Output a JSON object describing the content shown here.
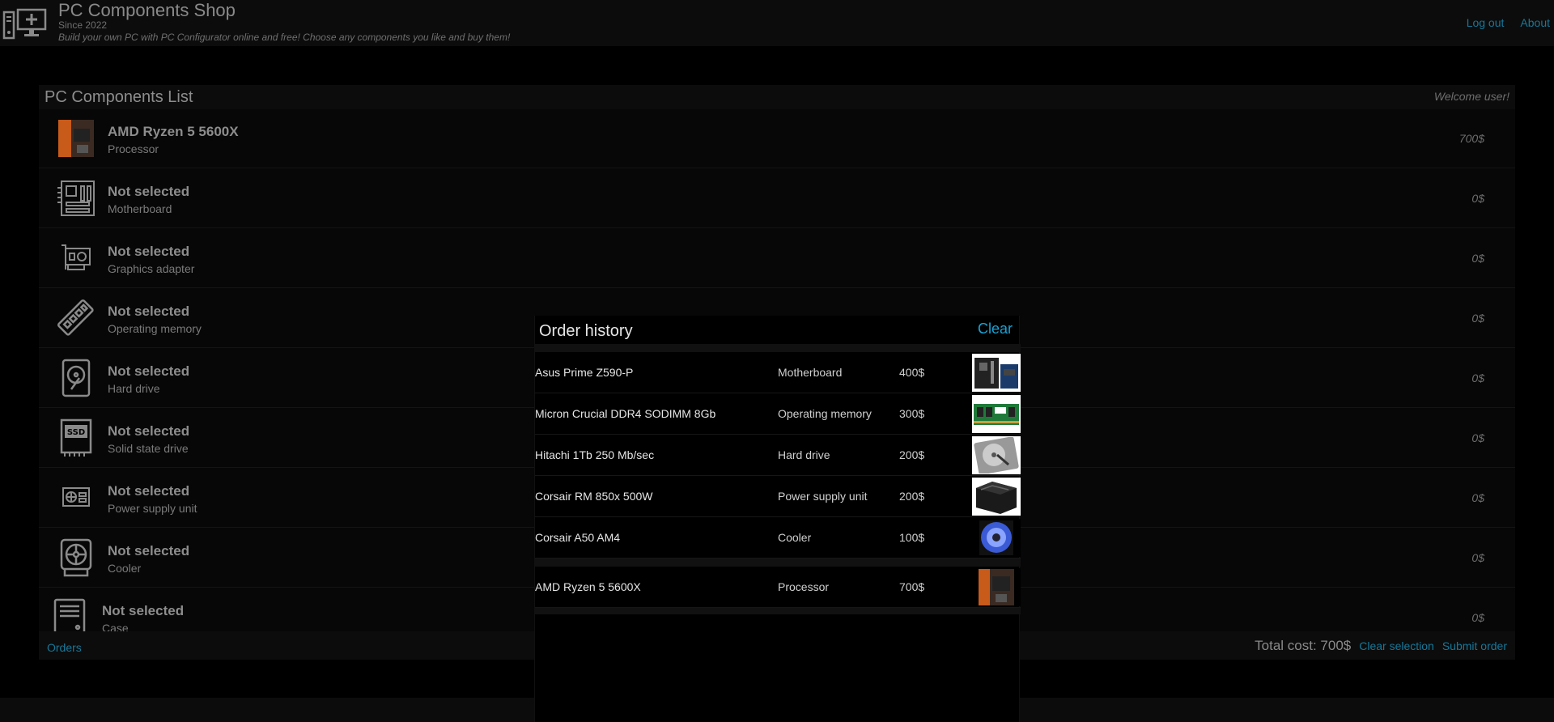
{
  "header": {
    "title": "PC Components Shop",
    "since": "Since 2022",
    "tagline": "Build your own PC with PC Configurator online and free! Choose any components you like and buy them!",
    "nav": {
      "logout": "Log out",
      "about": "About"
    }
  },
  "panel": {
    "title": "PC Components List",
    "welcome": "Welcome  user!",
    "components": [
      {
        "name": "AMD Ryzen 5 5600X",
        "type": "Processor",
        "price": "700$",
        "icon": "cpu-box-icon"
      },
      {
        "name": "Not selected",
        "type": "Motherboard",
        "price": "0$",
        "icon": "motherboard-icon"
      },
      {
        "name": "Not selected",
        "type": "Graphics adapter",
        "price": "0$",
        "icon": "gpu-icon"
      },
      {
        "name": "Not selected",
        "type": "Operating memory",
        "price": "0$",
        "icon": "ram-icon"
      },
      {
        "name": "Not selected",
        "type": "Hard drive",
        "price": "0$",
        "icon": "hdd-icon"
      },
      {
        "name": "Not selected",
        "type": "Solid state drive",
        "price": "0$",
        "icon": "ssd-icon"
      },
      {
        "name": "Not selected",
        "type": "Power supply unit",
        "price": "0$",
        "icon": "psu-icon"
      },
      {
        "name": "Not selected",
        "type": "Cooler",
        "price": "0$",
        "icon": "cooler-icon"
      },
      {
        "name": "Not selected",
        "type": "Case",
        "price": "0$",
        "icon": "case-icon"
      }
    ],
    "footer": {
      "orders": "Orders",
      "total": "Total cost: 700$",
      "clear_selection": "Clear selection",
      "submit_order": "Submit order"
    }
  },
  "modal": {
    "title": "Order history",
    "clear": "Clear",
    "orders": [
      [
        {
          "name": "Asus Prime Z590-P",
          "type": "Motherboard",
          "price": "400$"
        },
        {
          "name": "Micron Crucial DDR4 SODIMM 8Gb",
          "type": "Operating memory",
          "price": "300$"
        },
        {
          "name": "Hitachi 1Tb 250 Mb/sec",
          "type": "Hard drive",
          "price": "200$"
        },
        {
          "name": "Corsair RM 850x 500W",
          "type": "Power supply unit",
          "price": "200$"
        },
        {
          "name": "Corsair A50 AM4",
          "type": "Cooler",
          "price": "100$"
        }
      ],
      [
        {
          "name": "AMD Ryzen 5 5600X",
          "type": "Processor",
          "price": "700$"
        }
      ]
    ]
  },
  "colors": {
    "link": "#17789a",
    "modal_link": "#1aa3d4",
    "background": "#000000",
    "panel": "#0c0c0c"
  }
}
